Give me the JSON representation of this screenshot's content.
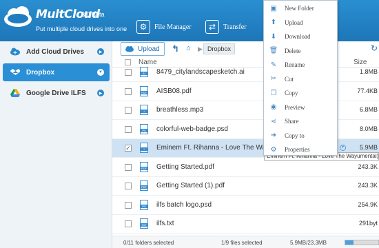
{
  "app": {
    "brand": "MultCloud",
    "version": "3.0 Beta",
    "tagline": "Put multiple cloud drives into one",
    "file_manager_label": "File Manager",
    "transfer_label": "Transfer"
  },
  "sidebar": {
    "items": [
      {
        "label": "Add Cloud Drives"
      },
      {
        "label": "Dropbox"
      },
      {
        "label": "Google Drive ILFS"
      }
    ]
  },
  "toolbar": {
    "upload_label": "Upload",
    "breadcrumb": "Dropbox"
  },
  "table": {
    "headers": {
      "name": "Name",
      "size": "Size"
    },
    "rows": [
      {
        "name": "8479_citylandscapesketch.ai",
        "size": "1.8MB",
        "icon": "ai-file-icon",
        "badge": "AI"
      },
      {
        "name": "AISB08.pdf",
        "size": "77.4KB",
        "icon": "pdf-file-icon",
        "badge": "PDF"
      },
      {
        "name": "breathless.mp3",
        "size": "6.8MB",
        "icon": "audio-file-icon",
        "badge": "♪"
      },
      {
        "name": "colorful-web-badge.psd",
        "size": "8.0MB",
        "icon": "psd-file-icon",
        "badge": "PS"
      },
      {
        "name": "Eminem Ft. Rihanna - Love The Wa(",
        "size": "5.9MB",
        "icon": "audio-file-icon",
        "badge": "♪"
      },
      {
        "name": "Getting Started.pdf",
        "size": "243.3K",
        "icon": "pdf-file-icon",
        "badge": "PDF"
      },
      {
        "name": "Getting Started (1).pdf",
        "size": "243.3K",
        "icon": "pdf-file-icon",
        "badge": "PDF"
      },
      {
        "name": "ilfs batch logo.psd",
        "size": "254.9K",
        "icon": "psd-file-icon",
        "badge": "PS"
      },
      {
        "name": "ilfs.txt",
        "size": "291byt",
        "icon": "txt-file-icon",
        "badge": "TXT"
      }
    ],
    "selected_row": 4
  },
  "tooltip": "Eminem Ft. Rihanna - Love The Wayumental) (i",
  "status": {
    "folders": "0/11 folders selected",
    "files": "1/9 files selected",
    "quota": "5.9MB/23.3MB",
    "quota_fraction": 0.25
  },
  "context_menu": {
    "items": [
      {
        "label": "New Folder",
        "icon": "new-folder-icon",
        "glyph": "▣"
      },
      {
        "label": "Upload",
        "icon": "upload-icon",
        "glyph": "⬆"
      },
      {
        "label": "Download",
        "icon": "download-icon",
        "glyph": "⬇"
      },
      {
        "label": "Delete",
        "icon": "delete-icon",
        "glyph": "🗑"
      },
      {
        "label": "Rename",
        "icon": "rename-icon",
        "glyph": "✎"
      },
      {
        "label": "Cut",
        "icon": "cut-icon",
        "glyph": "✂"
      },
      {
        "label": "Copy",
        "icon": "copy-icon",
        "glyph": "❐"
      },
      {
        "label": "Preview",
        "icon": "preview-icon",
        "glyph": "◉"
      },
      {
        "label": "Share",
        "icon": "share-icon",
        "glyph": "⋖"
      },
      {
        "label": "Copy to",
        "icon": "copy-to-icon",
        "glyph": "➜"
      },
      {
        "label": "Properties",
        "icon": "properties-icon",
        "glyph": "⚙"
      }
    ]
  },
  "colors": {
    "header": "#2a8fd0",
    "accent": "#2b8fd6",
    "selected_row": "#cfe2f3"
  }
}
